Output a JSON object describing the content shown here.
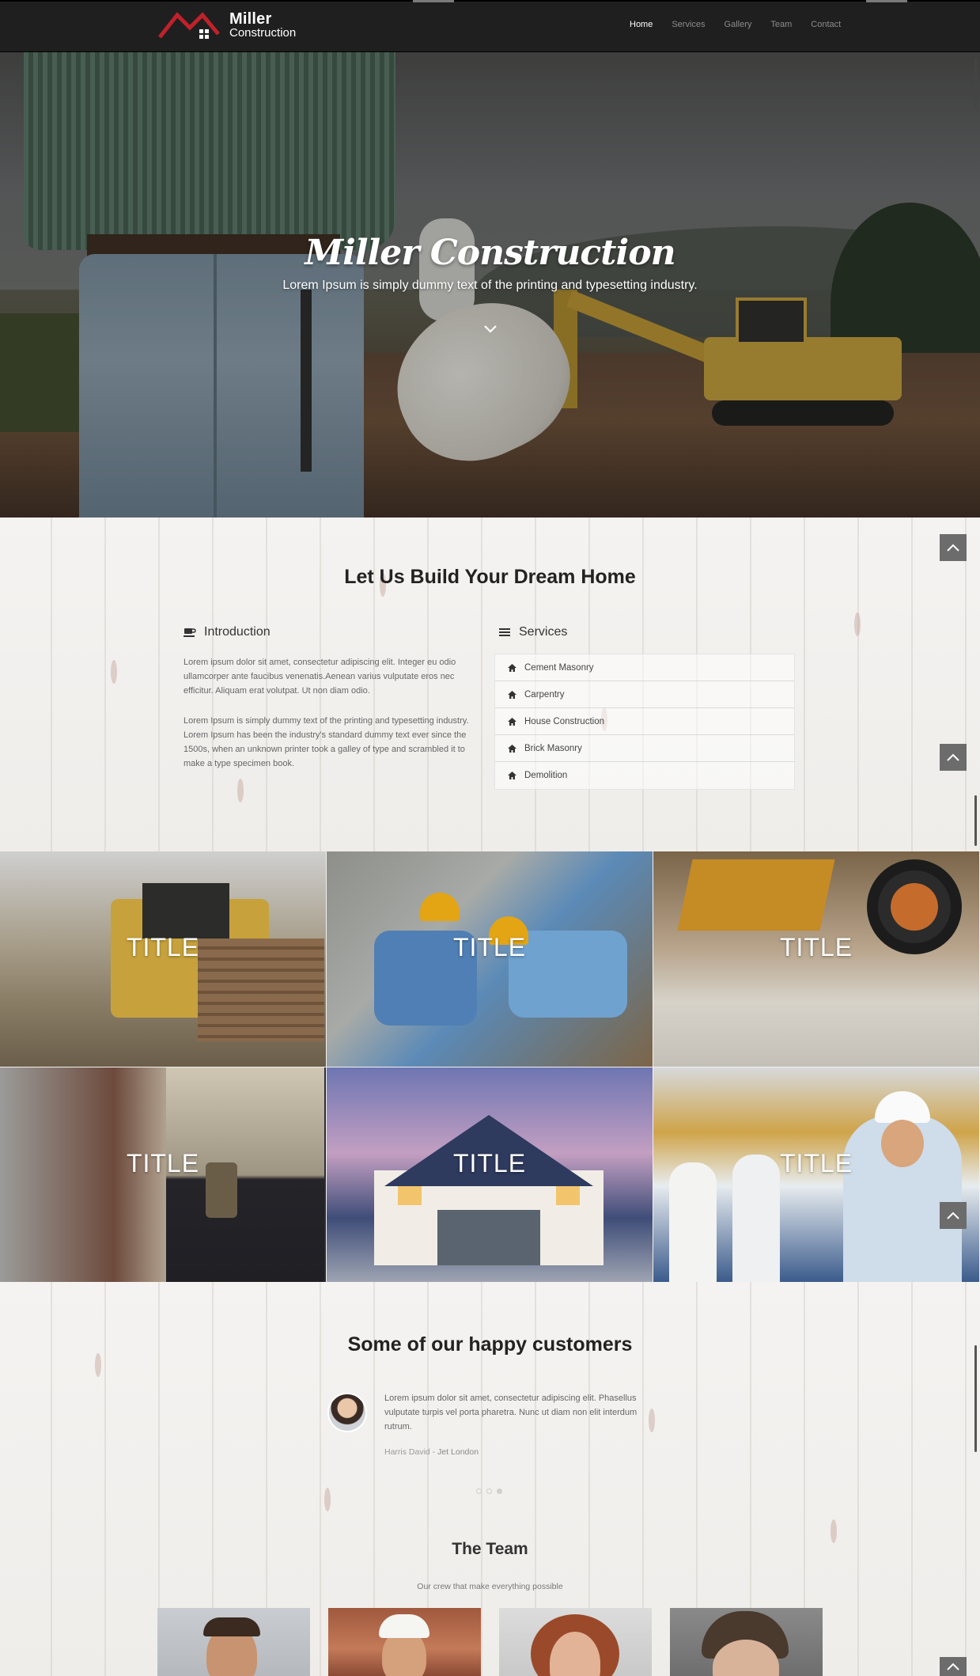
{
  "brand": {
    "line1": "Miller",
    "line2": "Construction",
    "logo_color": "#c0212b"
  },
  "nav": {
    "items": [
      "Home",
      "Services",
      "Gallery",
      "Team",
      "Contact"
    ],
    "active": "Home"
  },
  "hero": {
    "title": "Miller Construction",
    "subtitle": "Lorem Ipsum is simply dummy text of the printing and typesetting industry.",
    "scroll_icon": "chevron-down-icon"
  },
  "about": {
    "title": "Let Us Build Your Dream Home",
    "intro": {
      "heading": "Introduction",
      "icon": "coffee-cup-icon",
      "p1": "Lorem ipsum dolor sit amet, consectetur adipiscing elit. Integer eu odio ullamcorper ante faucibus venenatis.Aenean varius vulputate eros nec efficitur. Aliquam erat volutpat. Ut non diam odio.",
      "p2": "Lorem Ipsum is simply dummy text of the printing and typesetting industry. Lorem Ipsum has been the industry's standard dummy text ever since the 1500s, when an unknown printer took a galley of type and scrambled it to make a type specimen book."
    },
    "services": {
      "heading": "Services",
      "icon": "list-icon",
      "items": [
        "Cement Masonry",
        "Carpentry",
        "House Construction",
        "Brick Masonry",
        "Demolition"
      ]
    }
  },
  "gallery": {
    "tiles": [
      "TITLE",
      "TITLE",
      "TITLE",
      "TITLE",
      "TITLE",
      "TITLE"
    ]
  },
  "testimonials": {
    "title": "Some of our happy customers",
    "quote": "Lorem ipsum dolor sit amet, consectetur adipiscing elit. Phasellus vulputate turpis vel porta pharetra. Nunc ut diam non elit interdum rutrum.",
    "author": "Harris David",
    "separator": " - ",
    "location": "Jet London",
    "dots": 3,
    "active_dot": 1
  },
  "team": {
    "title": "The Team",
    "subtitle": "Our crew that make everything possible"
  },
  "back_to_top_icon": "chevron-up-icon"
}
